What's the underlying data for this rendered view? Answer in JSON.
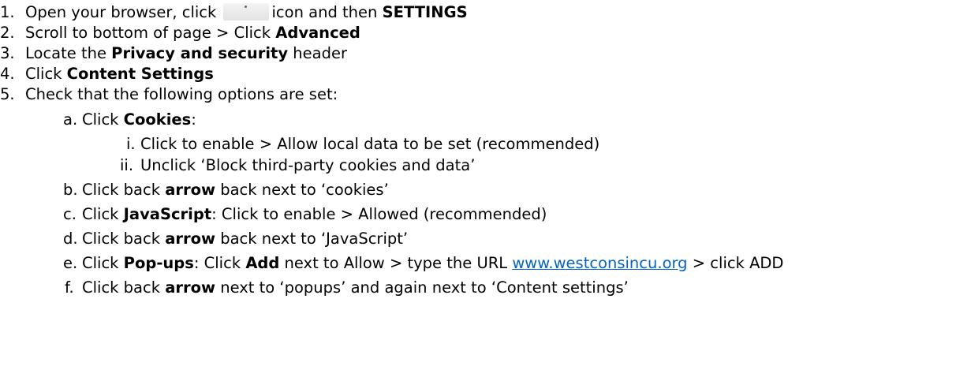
{
  "steps": [
    {
      "num": "1.",
      "parts": [
        "Open your browser, click",
        "icon and then",
        "SETTINGS"
      ]
    },
    {
      "num": "2.",
      "parts": [
        "Scroll to bottom of page > Click",
        "Advanced"
      ]
    },
    {
      "num": "3.",
      "parts": [
        "Locate the",
        "Privacy and security",
        "header"
      ]
    },
    {
      "num": "4.",
      "parts": [
        "Click",
        "Content Settings"
      ]
    },
    {
      "num": "5.",
      "parts": [
        "Check that the following options are set:"
      ]
    }
  ],
  "substeps": [
    {
      "num": "a.",
      "parts": [
        "Click",
        "Cookies",
        ":"
      ]
    },
    {
      "num": "b.",
      "parts": [
        "Click back",
        "arrow",
        "back next to ‘cookies’"
      ]
    },
    {
      "num": "c.",
      "parts": [
        "Click",
        "JavaScript",
        ": Click to enable > Allowed (recommended)"
      ]
    },
    {
      "num": "d.",
      "parts": [
        "Click back",
        "arrow",
        "back next to ‘JavaScript’"
      ]
    },
    {
      "num": "e.",
      "parts": [
        "Click",
        "Pop-ups",
        ": Click",
        "Add",
        "next to Allow > type the URL",
        "www.westconsincu.org",
        "> click ADD"
      ]
    },
    {
      "num": "f.",
      "parts": [
        "Click back",
        "arrow",
        "next to ‘popups’ and again next to ‘Content settings’"
      ]
    }
  ],
  "cookie_steps": [
    {
      "num": "i.",
      "text": "Click to enable > Allow local data to be set (recommended)"
    },
    {
      "num": "ii.",
      "text": "Unclick ‘Block third-party cookies and data’"
    }
  ],
  "icons": {
    "menu": "chrome-menu-icon"
  },
  "colors": {
    "link": "#0563c1",
    "text": "#000000"
  }
}
